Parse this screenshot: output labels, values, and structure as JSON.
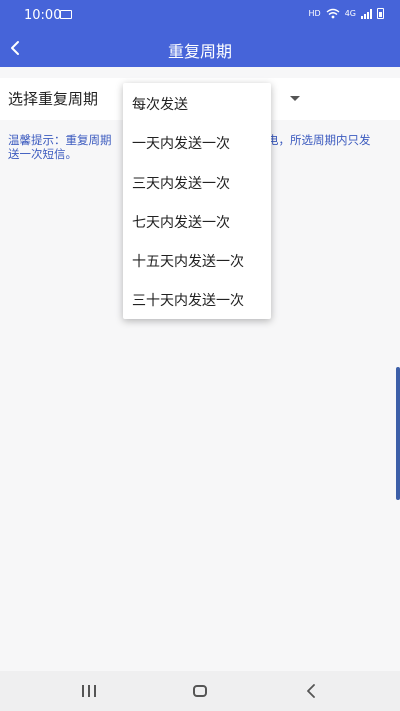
{
  "status_bar": {
    "time": "10:00",
    "hd": "HD",
    "network": "4G"
  },
  "app_bar": {
    "title": "重复周期"
  },
  "select": {
    "label": "选择重复周期"
  },
  "hint": {
    "text_start": "温馨提示：重复周期",
    "text_end": "电，所选周期内只发",
    "text_line2": "送一次短信。"
  },
  "dropdown": {
    "options": [
      "每次发送",
      "一天内发送一次",
      "三天内发送一次",
      "七天内发送一次",
      "十五天内发送一次",
      "三十天内发送一次"
    ]
  },
  "colors": {
    "primary": "#4664d9",
    "hint_text": "#3c5bbf"
  }
}
